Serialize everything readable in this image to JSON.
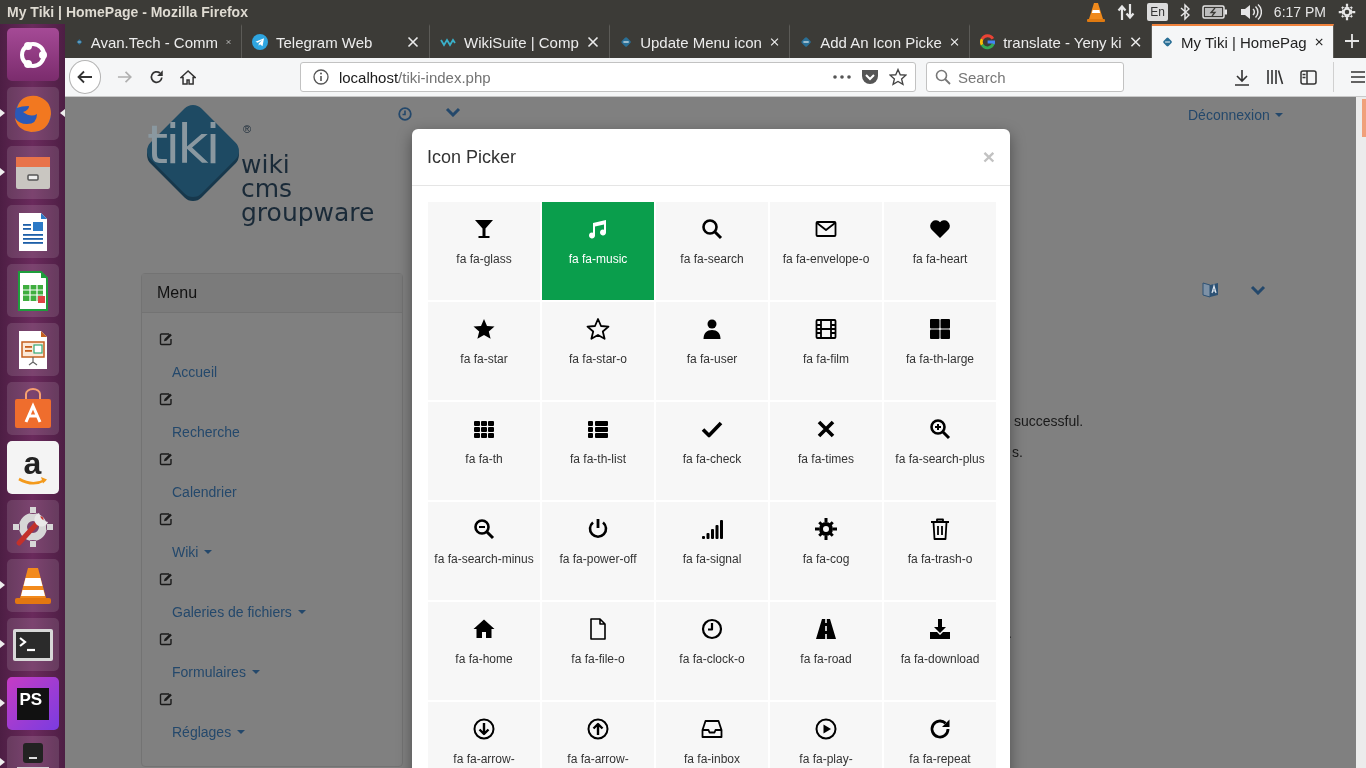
{
  "top_bar": {
    "title": "My Tiki | HomePage - Mozilla Firefox",
    "keyboard": "En",
    "clock": "6:17 PM"
  },
  "launcher": [
    {
      "running": false,
      "focused": false
    },
    {
      "running": true,
      "focused": true
    },
    {
      "running": true,
      "focused": false
    },
    {
      "running": false,
      "focused": false
    },
    {
      "running": false,
      "focused": false
    },
    {
      "running": false,
      "focused": false
    },
    {
      "running": false,
      "focused": false
    },
    {
      "running": false,
      "focused": false,
      "label": "a"
    },
    {
      "running": false,
      "focused": false
    },
    {
      "running": true,
      "focused": false
    },
    {
      "running": true,
      "focused": false
    },
    {
      "running": true,
      "focused": false,
      "label": "PS"
    },
    {
      "running": true,
      "focused": false
    }
  ],
  "tabs": [
    {
      "label": "Avan.Tech - Comm",
      "selected": false
    },
    {
      "label": "Telegram Web",
      "selected": false
    },
    {
      "label": "WikiSuite | Comp",
      "selected": false
    },
    {
      "label": "Update Menu icon",
      "selected": false
    },
    {
      "label": "Add An Icon Picke",
      "selected": false
    },
    {
      "label": "translate - Yeny ki",
      "selected": false
    },
    {
      "label": "My Tiki | HomePag",
      "selected": true
    }
  ],
  "nav": {
    "url_host": "localhost",
    "url_path": "/tiki-index.php",
    "search_placeholder": "Search"
  },
  "page": {
    "logo": {
      "mark": "tiki",
      "registered": "®",
      "lines": [
        "wiki",
        "cms",
        "groupware"
      ]
    },
    "logout": "Déconnexion",
    "menu": {
      "title": "Menu",
      "items": [
        {
          "label": "Accueil",
          "dropdown": false
        },
        {
          "label": "Recherche",
          "dropdown": false
        },
        {
          "label": "Calendrier",
          "dropdown": false
        },
        {
          "label": "Wiki",
          "dropdown": true
        },
        {
          "label": "Galeries de fichiers",
          "dropdown": true
        },
        {
          "label": "Formulaires",
          "dropdown": true
        },
        {
          "label": "Réglages",
          "dropdown": true
        }
      ]
    },
    "fragments": [
      "successful.",
      "s.",
      "."
    ]
  },
  "modal": {
    "title": "Icon Picker",
    "close": "×",
    "icons": [
      {
        "label": "fa fa-glass",
        "selected": false
      },
      {
        "label": "fa fa-music",
        "selected": true
      },
      {
        "label": "fa fa-search",
        "selected": false
      },
      {
        "label": "fa fa-envelope-o",
        "selected": false
      },
      {
        "label": "fa fa-heart",
        "selected": false
      },
      {
        "label": "fa fa-star",
        "selected": false
      },
      {
        "label": "fa fa-star-o",
        "selected": false
      },
      {
        "label": "fa fa-user",
        "selected": false
      },
      {
        "label": "fa fa-film",
        "selected": false
      },
      {
        "label": "fa fa-th-large",
        "selected": false
      },
      {
        "label": "fa fa-th",
        "selected": false
      },
      {
        "label": "fa fa-th-list",
        "selected": false
      },
      {
        "label": "fa fa-check",
        "selected": false
      },
      {
        "label": "fa fa-times",
        "selected": false
      },
      {
        "label": "fa fa-search-plus",
        "selected": false
      },
      {
        "label": "fa fa-search-minus",
        "selected": false
      },
      {
        "label": "fa fa-power-off",
        "selected": false
      },
      {
        "label": "fa fa-signal",
        "selected": false
      },
      {
        "label": "fa fa-cog",
        "selected": false
      },
      {
        "label": "fa fa-trash-o",
        "selected": false
      },
      {
        "label": "fa fa-home",
        "selected": false
      },
      {
        "label": "fa fa-file-o",
        "selected": false
      },
      {
        "label": "fa fa-clock-o",
        "selected": false
      },
      {
        "label": "fa fa-road",
        "selected": false
      },
      {
        "label": "fa fa-download",
        "selected": false
      },
      {
        "label": "fa fa-arrow-",
        "selected": false
      },
      {
        "label": "fa fa-arrow-",
        "selected": false
      },
      {
        "label": "fa fa-inbox",
        "selected": false
      },
      {
        "label": "fa fa-play-",
        "selected": false
      },
      {
        "label": "fa fa-repeat",
        "selected": false
      }
    ]
  }
}
